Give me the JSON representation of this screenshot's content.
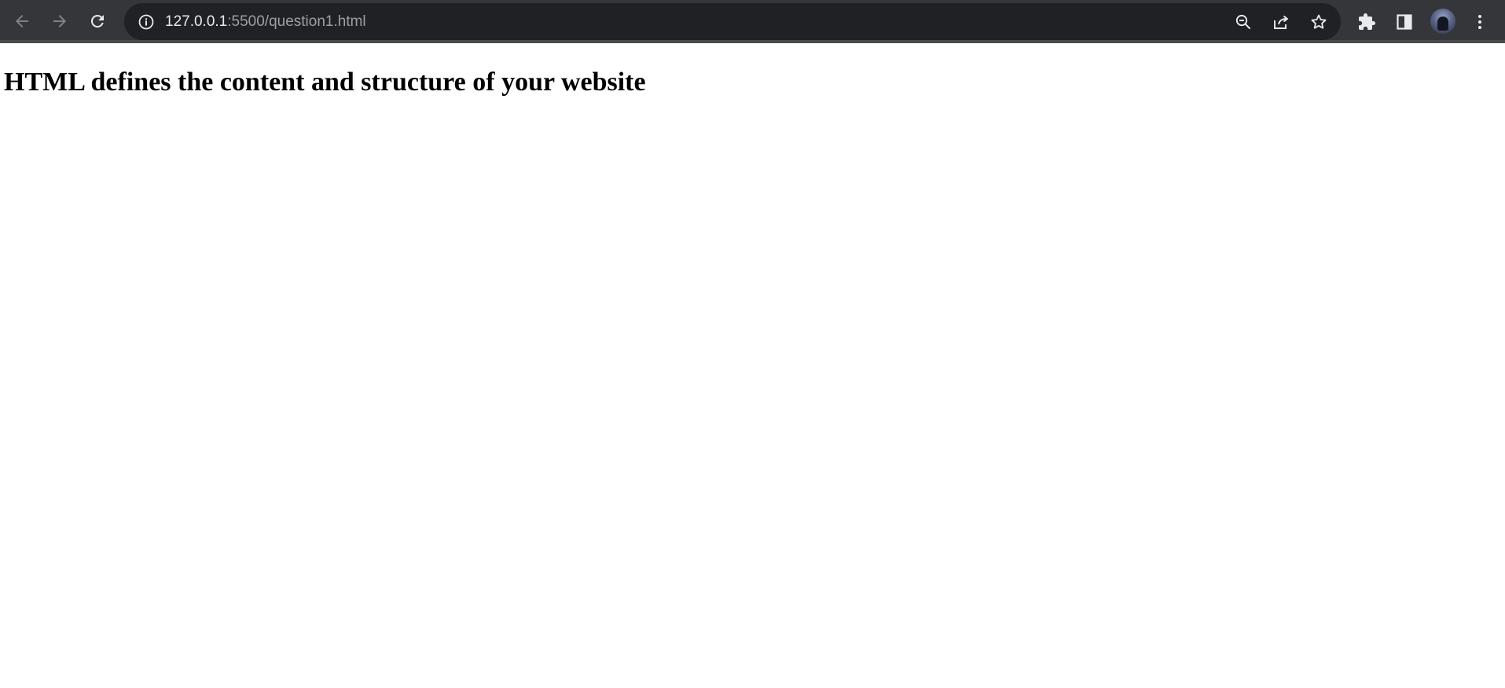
{
  "browser": {
    "url_host": "127.0.0.1",
    "url_path": ":5500/question1.html",
    "icons": {
      "back": "arrow-left-icon",
      "forward": "arrow-right-icon",
      "reload": "reload-icon",
      "site_info": "info-icon",
      "zoom": "zoom-out-icon",
      "share": "share-icon",
      "bookmark": "star-icon",
      "extensions": "puzzle-icon",
      "side_panel": "side-panel-icon",
      "menu": "kebab-menu-icon"
    }
  },
  "page": {
    "heading": "HTML defines the content and structure of your website"
  }
}
